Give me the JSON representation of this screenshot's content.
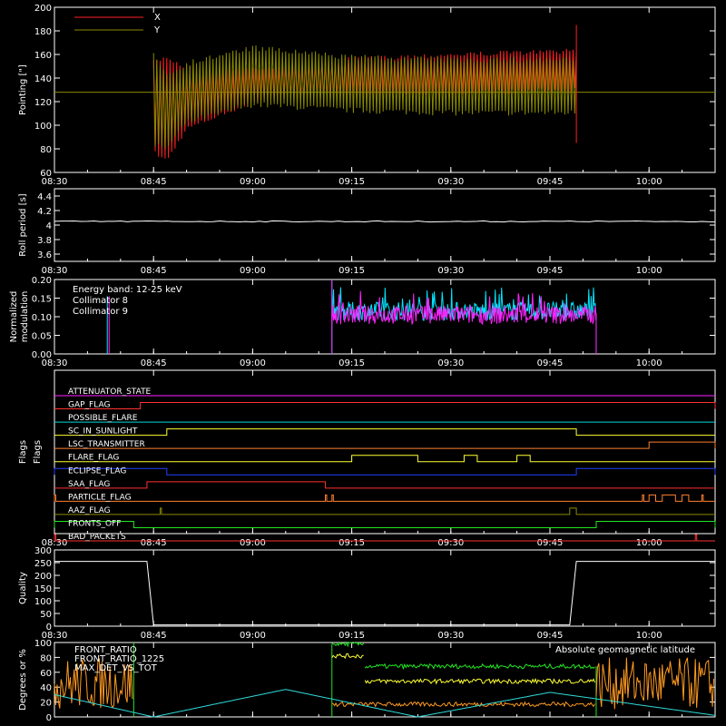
{
  "time_ticks": [
    "08:30",
    "08:45",
    "09:00",
    "09:15",
    "09:30",
    "09:45",
    "10:00"
  ],
  "colors": {
    "x_series": "#ff2020",
    "y_series": "#8a8a00",
    "collimator_8": "#00e5ff",
    "collimator_9": "#ff22ff",
    "front_ratio": "#ff9a20",
    "front_ratio_1225": "#22e622",
    "max_det_vs_tot": "#ffff33",
    "geomag_lat": "#30d8d8"
  },
  "chart_data": [
    {
      "type": "line",
      "id": "pointing",
      "ylabel": "Pointing [\"]",
      "ylim": [
        60,
        200
      ],
      "yticks": [
        60,
        80,
        100,
        120,
        140,
        160,
        180,
        200
      ],
      "xlim": [
        "08:30",
        "10:10"
      ],
      "series": [
        {
          "name": "X",
          "envelope": [
            {
              "t": "08:45",
              "lo": 75,
              "hi": 155
            },
            {
              "t": "08:47",
              "lo": 68,
              "hi": 160
            },
            {
              "t": "08:50",
              "lo": 95,
              "hi": 150
            },
            {
              "t": "09:00",
              "lo": 118,
              "hi": 150
            },
            {
              "t": "09:15",
              "lo": 124,
              "hi": 158
            },
            {
              "t": "09:30",
              "lo": 125,
              "hi": 162
            },
            {
              "t": "09:49",
              "lo": 128,
              "hi": 165
            }
          ]
        },
        {
          "name": "Y",
          "envelope": [
            {
              "t": "08:45",
              "lo": 80,
              "hi": 165
            },
            {
              "t": "08:47",
              "lo": 78,
              "hi": 145
            },
            {
              "t": "08:50",
              "lo": 100,
              "hi": 155
            },
            {
              "t": "09:00",
              "lo": 115,
              "hi": 168
            },
            {
              "t": "09:15",
              "lo": 110,
              "hi": 160
            },
            {
              "t": "09:30",
              "lo": 108,
              "hi": 158
            },
            {
              "t": "09:49",
              "lo": 108,
              "hi": 158
            }
          ],
          "baseline": 128
        }
      ]
    },
    {
      "type": "line",
      "id": "roll",
      "ylabel": "Roll period [s]",
      "ylim": [
        3.5,
        4.5
      ],
      "yticks": [
        3.6,
        3.8,
        4.0,
        4.2,
        4.4
      ],
      "xlim": [
        "08:30",
        "10:10"
      ],
      "series": [
        {
          "name": "",
          "value": 4.05
        }
      ]
    },
    {
      "type": "line",
      "id": "modulation",
      "ylabel": "Normalized modulation",
      "ylim": [
        0,
        0.2
      ],
      "yticks": [
        "0.00",
        "0.05",
        "0.10",
        "0.15",
        "0.20"
      ],
      "xlim": [
        "08:30",
        "10:10"
      ],
      "annotation": "Energy band: 12-25 keV",
      "series": [
        {
          "name": "Collimator 8",
          "spike_at": "08:38",
          "band": {
            "start": "09:12",
            "end": "09:52",
            "lo": 0.09,
            "hi": 0.14
          }
        },
        {
          "name": "Collimator 9",
          "spike_at": "08:38",
          "band": {
            "start": "09:12",
            "end": "09:52",
            "lo": 0.08,
            "hi": 0.13
          }
        }
      ]
    },
    {
      "type": "line",
      "id": "flags",
      "ylabel": "Flags",
      "xlim": [
        "08:30",
        "10:10"
      ],
      "flags": [
        {
          "name": "ATTENUATOR_STATE",
          "color": "#ff22ff",
          "on": []
        },
        {
          "name": "GAP_FLAG",
          "color": "#ff3030",
          "on": [
            [
              "08:43",
              "10:10"
            ]
          ]
        },
        {
          "name": "POSSIBLE_FLARE",
          "color": "#00d8d8",
          "on": []
        },
        {
          "name": "SC_IN_SUNLIGHT",
          "color": "#ffff33",
          "on": [
            [
              "08:47",
              "09:49"
            ]
          ]
        },
        {
          "name": "LSC_TRANSMITTER",
          "color": "#ff8030",
          "on": [
            [
              "10:00",
              "10:10"
            ]
          ]
        },
        {
          "name": "FLARE_FLAG",
          "color": "#ffff33",
          "on": [
            [
              "09:15",
              "09:25"
            ],
            [
              "09:32",
              "09:34"
            ],
            [
              "09:40",
              "09:42"
            ]
          ]
        },
        {
          "name": "ECLIPSE_FLAG",
          "color": "#2040ff",
          "on": [
            [
              "08:30",
              "08:47"
            ],
            [
              "09:49",
              "10:10"
            ]
          ]
        },
        {
          "name": "SAA_FLAG",
          "color": "#ff3030",
          "on": [
            [
              "08:44",
              "09:11"
            ]
          ]
        },
        {
          "name": "PARTICLE_FLAG",
          "color": "#ff8030",
          "on": [
            [
              "08:30",
              "08:30"
            ],
            [
              "09:11",
              "09:11"
            ],
            [
              "09:12",
              "09:12"
            ],
            [
              "09:59",
              "09:59"
            ],
            [
              "10:00",
              "10:01"
            ],
            [
              "10:02",
              "10:04"
            ],
            [
              "10:05",
              "10:06"
            ],
            [
              "10:08",
              "10:08"
            ]
          ]
        },
        {
          "name": "AAZ_FLAG",
          "color": "#8a8a00",
          "on": [
            [
              "08:46",
              "08:46"
            ],
            [
              "09:48",
              "09:49"
            ]
          ]
        },
        {
          "name": "FRONTS_OFF",
          "color": "#22e622",
          "on": [
            [
              "08:30",
              "08:42"
            ],
            [
              "09:52",
              "10:10"
            ]
          ]
        },
        {
          "name": "BAD_PACKETS",
          "color": "#ff3030",
          "on": [
            [
              "08:30",
              "08:30"
            ],
            [
              "10:07",
              "10:07"
            ]
          ]
        }
      ]
    },
    {
      "type": "line",
      "id": "quality",
      "ylabel": "Quality",
      "ylim": [
        0,
        300
      ],
      "yticks": [
        0,
        50,
        100,
        150,
        200,
        250,
        300
      ],
      "xlim": [
        "08:30",
        "10:10"
      ],
      "series": [
        {
          "name": "",
          "segments": [
            {
              "t": "08:30",
              "v": 255
            },
            {
              "t": "08:44",
              "v": 255
            },
            {
              "t": "08:45",
              "v": 5
            },
            {
              "t": "09:48",
              "v": 5
            },
            {
              "t": "09:49",
              "v": 255
            },
            {
              "t": "10:10",
              "v": 255
            }
          ]
        }
      ]
    },
    {
      "type": "line",
      "id": "degrees",
      "ylabel": "Degrees or %",
      "ylim": [
        0,
        100
      ],
      "yticks": [
        0,
        20,
        40,
        60,
        80,
        100
      ],
      "xlim": [
        "08:30",
        "10:10"
      ],
      "annotation": "Absolute geomagnetic latitude",
      "series": [
        {
          "name": "FRONT_RATIO",
          "levels": [
            {
              "start": "08:30",
              "end": "08:42",
              "v": 45
            },
            {
              "start": "09:12",
              "end": "09:52",
              "v": 17
            },
            {
              "start": "09:52",
              "end": "10:10",
              "v": 45
            }
          ]
        },
        {
          "name": "FRONT_RATIO_1225",
          "levels": [
            {
              "start": "09:12",
              "end": "09:17",
              "v": 98
            },
            {
              "start": "09:17",
              "end": "09:52",
              "v": 68
            }
          ]
        },
        {
          "name": "MAX_DET_VS_TOT",
          "levels": [
            {
              "start": "09:12",
              "end": "09:17",
              "v": 82
            },
            {
              "start": "09:17",
              "end": "09:52",
              "v": 48
            }
          ]
        },
        {
          "name": "Absolute geomagnetic latitude",
          "curve": [
            {
              "t": "08:30",
              "v": 30
            },
            {
              "t": "08:45",
              "v": 0
            },
            {
              "t": "09:05",
              "v": 37
            },
            {
              "t": "09:25",
              "v": 0
            },
            {
              "t": "09:45",
              "v": 33
            },
            {
              "t": "10:10",
              "v": 2
            }
          ]
        }
      ]
    }
  ]
}
